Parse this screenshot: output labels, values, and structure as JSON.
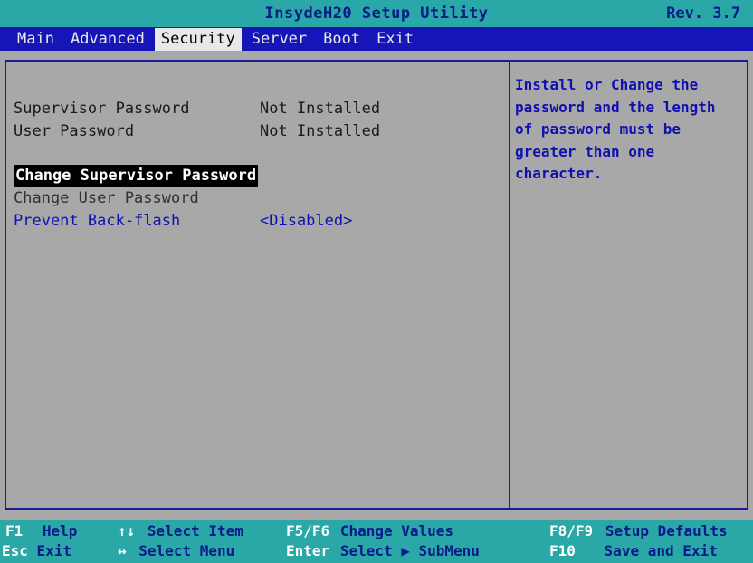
{
  "title": "InsydeH20 Setup Utility",
  "revision": "Rev. 3.7",
  "menu": [
    {
      "label": "Main",
      "active": false
    },
    {
      "label": "Advanced",
      "active": false
    },
    {
      "label": "Security",
      "active": true
    },
    {
      "label": "Server",
      "active": false
    },
    {
      "label": "Boot",
      "active": false
    },
    {
      "label": "Exit",
      "active": false
    }
  ],
  "security": {
    "supervisor_password": {
      "label": "Supervisor Password",
      "value": "Not Installed"
    },
    "user_password": {
      "label": "User Password",
      "value": "Not Installed"
    },
    "change_supervisor_password": {
      "label": "Change Supervisor Password"
    },
    "change_user_password": {
      "label": "Change User Password"
    },
    "prevent_back_flash": {
      "label": "Prevent Back-flash",
      "value": "<Disabled>"
    }
  },
  "help": {
    "lines": [
      "Install or Change the",
      "password and the length",
      "of password  must be",
      "greater than one",
      "character."
    ]
  },
  "hotkeys": {
    "f1": {
      "key": "F1",
      "desc": "Help"
    },
    "esc": {
      "key": "Esc",
      "desc": "Exit"
    },
    "select_item": {
      "key": "↑↓",
      "desc": "Select Item"
    },
    "select_menu": {
      "key": "↔",
      "desc": "Select Menu"
    },
    "f5f6": {
      "key": "F5/F6",
      "desc": "Change Values"
    },
    "enter": {
      "key": "Enter",
      "desc": "Select ▶ SubMenu"
    },
    "f8f9": {
      "key": "F8/F9",
      "desc": "Setup Defaults"
    },
    "f10": {
      "key": "F10",
      "desc": "Save and Exit"
    }
  },
  "colors": {
    "background": "#a8a8a8",
    "title_bar": "#2aa7a7",
    "menu_bar": "#1616b8",
    "help_text": "#1010b0"
  }
}
